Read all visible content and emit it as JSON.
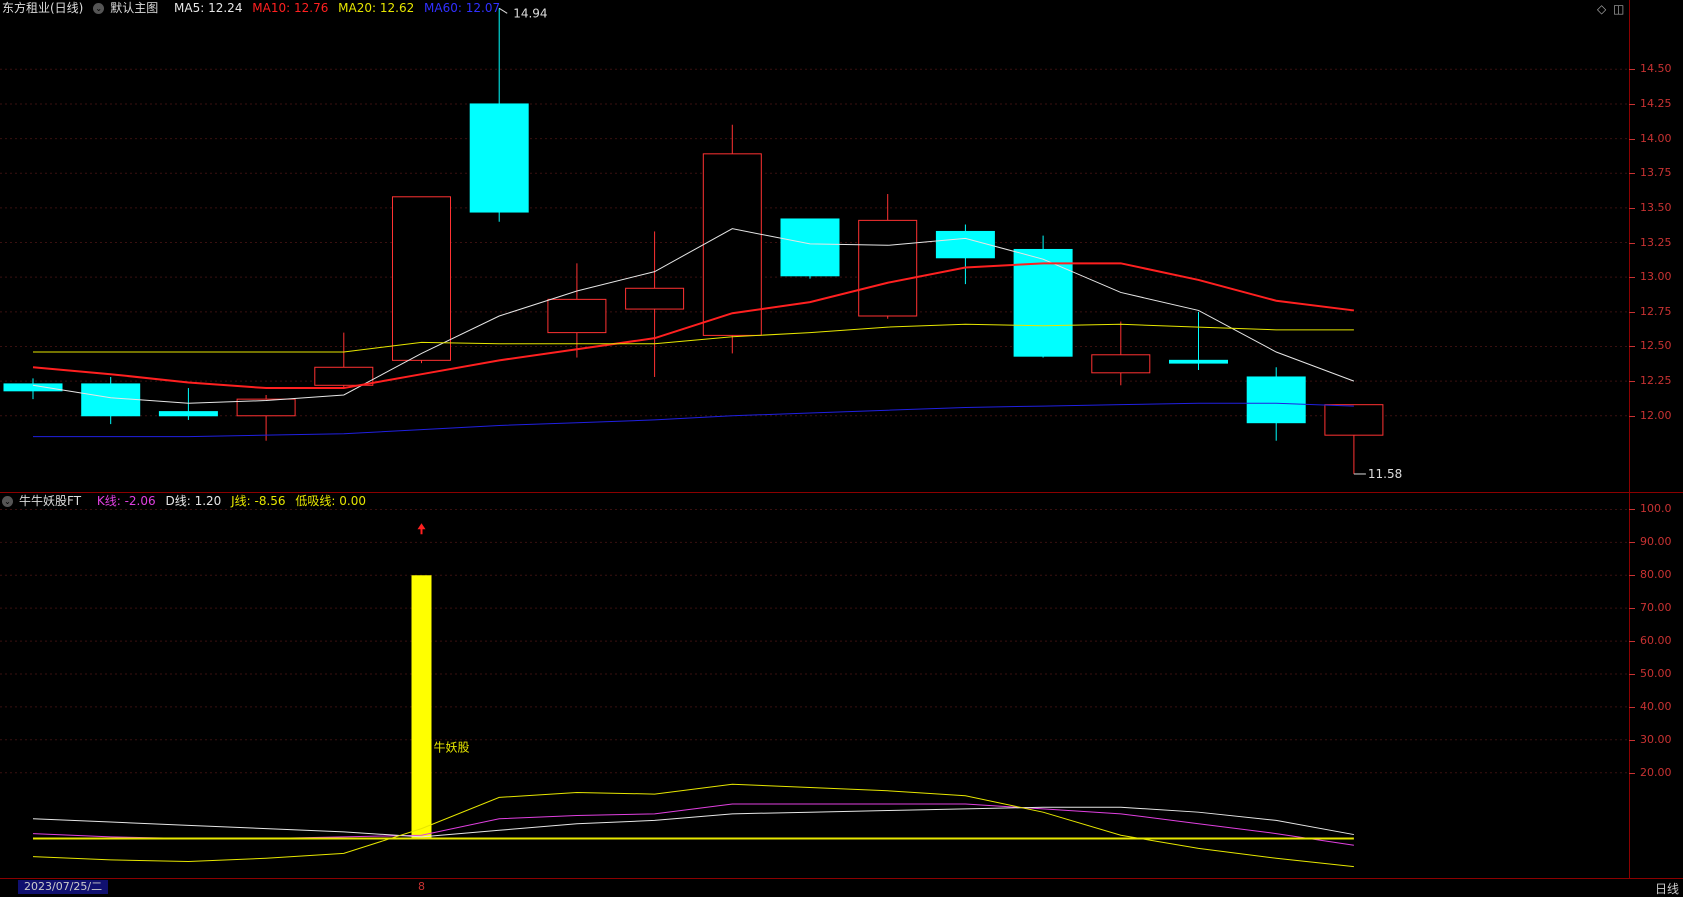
{
  "main_panel": {
    "stock_title": "东方租业(日线)",
    "chart_mode": "默认主图",
    "ma_items": [
      {
        "label": "MA5: 12.24",
        "color": "#e6e6e6"
      },
      {
        "label": "MA10: 12.76",
        "color": "#ff2020"
      },
      {
        "label": "MA20: 12.62",
        "color": "#e6e600"
      },
      {
        "label": "MA60: 12.07",
        "color": "#3030ff"
      }
    ],
    "high_label": "14.94",
    "low_label": "11.58",
    "y_ticks": [
      "14.50",
      "14.25",
      "14.00",
      "13.75",
      "13.50",
      "13.25",
      "13.00",
      "12.75",
      "12.50",
      "12.25",
      "12.00"
    ]
  },
  "indicator_panel": {
    "name": "牛牛妖股FT",
    "items": [
      {
        "label": "K线: -2.06",
        "color": "#e040e0"
      },
      {
        "label": "D线: 1.20",
        "color": "#e6e6e6"
      },
      {
        "label": "J线: -8.56",
        "color": "#e6e600"
      },
      {
        "label": "低吸线: 0.00",
        "color": "#e6e600"
      }
    ],
    "signal_label": "牛妖股",
    "y_ticks": [
      "100.0",
      "90.00",
      "80.00",
      "70.00",
      "60.00",
      "50.00",
      "40.00",
      "30.00",
      "20.00"
    ]
  },
  "footer": {
    "date": "2023/07/25/二",
    "marker": "8",
    "period": "日线"
  },
  "chart_data": [
    {
      "type": "candlestick",
      "ylim": [
        11.45,
        15.0
      ],
      "candles": [
        {
          "open": 12.23,
          "close": 12.18,
          "high": 12.27,
          "low": 12.12
        },
        {
          "open": 12.23,
          "close": 12.0,
          "high": 12.28,
          "low": 11.94
        },
        {
          "open": 12.03,
          "close": 12.0,
          "high": 12.2,
          "low": 11.97
        },
        {
          "open": 12.0,
          "close": 12.12,
          "high": 12.15,
          "low": 11.82
        },
        {
          "open": 12.22,
          "close": 12.35,
          "high": 12.6,
          "low": 12.2
        },
        {
          "open": 12.4,
          "close": 13.58,
          "high": 13.58,
          "low": 12.38
        },
        {
          "open": 14.25,
          "close": 13.47,
          "high": 14.94,
          "low": 13.4
        },
        {
          "open": 12.6,
          "close": 12.84,
          "high": 13.1,
          "low": 12.42
        },
        {
          "open": 12.77,
          "close": 12.92,
          "high": 13.33,
          "low": 12.28
        },
        {
          "open": 12.58,
          "close": 13.89,
          "high": 14.1,
          "low": 12.45
        },
        {
          "open": 13.42,
          "close": 13.01,
          "high": 13.42,
          "low": 12.99
        },
        {
          "open": 12.72,
          "close": 13.41,
          "high": 13.6,
          "low": 12.7
        },
        {
          "open": 13.33,
          "close": 13.14,
          "high": 13.38,
          "low": 12.95
        },
        {
          "open": 13.2,
          "close": 12.43,
          "high": 13.3,
          "low": 12.42
        },
        {
          "open": 12.31,
          "close": 12.44,
          "high": 12.68,
          "low": 12.22
        },
        {
          "open": 12.4,
          "close": 12.38,
          "high": 12.75,
          "low": 12.33
        },
        {
          "open": 12.28,
          "close": 11.95,
          "high": 12.35,
          "low": 11.82
        },
        {
          "open": 11.86,
          "close": 12.08,
          "high": 12.08,
          "low": 11.58
        }
      ],
      "series": [
        {
          "name": "MA5",
          "color": "#e6e6e6",
          "values": [
            12.22,
            12.13,
            12.09,
            12.11,
            12.15,
            12.45,
            12.72,
            12.9,
            13.04,
            13.35,
            13.24,
            13.23,
            13.28,
            13.13,
            12.89,
            12.76,
            12.46,
            12.25
          ]
        },
        {
          "name": "MA10",
          "color": "#ff2020",
          "values": [
            12.35,
            12.3,
            12.24,
            12.2,
            12.2,
            12.3,
            12.4,
            12.48,
            12.56,
            12.74,
            12.82,
            12.96,
            13.07,
            13.1,
            13.1,
            12.98,
            12.83,
            12.76
          ]
        },
        {
          "name": "MA20",
          "color": "#e6e600",
          "values": [
            12.46,
            12.46,
            12.46,
            12.46,
            12.46,
            12.53,
            12.52,
            12.52,
            12.52,
            12.57,
            12.6,
            12.64,
            12.66,
            12.65,
            12.66,
            12.64,
            12.62,
            12.62
          ]
        },
        {
          "name": "MA60",
          "color": "#2020e0",
          "values": [
            11.85,
            11.85,
            11.85,
            11.86,
            11.87,
            11.9,
            11.93,
            11.95,
            11.97,
            12.0,
            12.02,
            12.04,
            12.06,
            12.07,
            12.08,
            12.09,
            12.09,
            12.07
          ]
        }
      ]
    },
    {
      "type": "line",
      "ylim": [
        -12,
        105
      ],
      "series": [
        {
          "name": "K线",
          "color": "#e040e0",
          "values": [
            1.5,
            0.5,
            0.0,
            0.0,
            0.5,
            1.0,
            6.0,
            7.0,
            7.5,
            10.5,
            10.5,
            10.5,
            10.5,
            9.0,
            7.5,
            4.5,
            1.5,
            -2.06
          ]
        },
        {
          "name": "D线",
          "color": "#e6e6e6",
          "values": [
            6.0,
            5.0,
            4.0,
            3.0,
            2.0,
            0.5,
            2.5,
            4.5,
            5.5,
            7.5,
            8.0,
            8.5,
            9.0,
            9.5,
            9.5,
            8.0,
            5.5,
            1.2
          ]
        },
        {
          "name": "J线",
          "color": "#e6e600",
          "values": [
            -5.5,
            -6.5,
            -7.0,
            -6.0,
            -4.5,
            3.0,
            12.5,
            14.0,
            13.5,
            16.5,
            15.5,
            14.5,
            13.0,
            8.0,
            1.0,
            -3.0,
            -6.0,
            -8.56
          ]
        },
        {
          "name": "低吸线",
          "color": "#e6e600",
          "values": [
            0,
            0,
            0,
            0,
            0,
            0,
            0,
            0,
            0,
            0,
            0,
            0,
            0,
            0,
            0,
            0,
            0,
            0
          ]
        }
      ],
      "bars": [
        {
          "index": 5,
          "value": 80,
          "color": "#ffff00"
        }
      ]
    }
  ]
}
